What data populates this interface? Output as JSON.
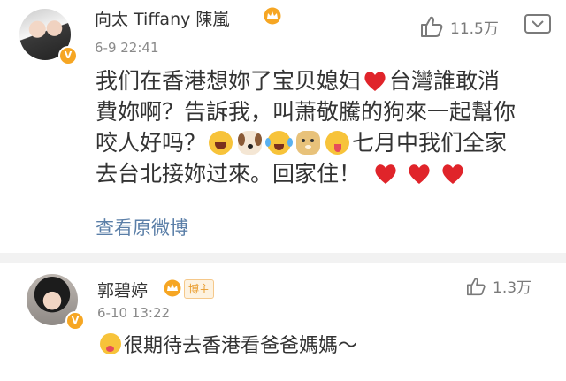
{
  "comments": [
    {
      "name": "向太 Tiffany 陳嵐",
      "time": "6-9 22:41",
      "likes": "11.5万",
      "text": {
        "l1a": "我们在香港想妳了宝贝媳妇",
        "l1b": "台灣誰敢消",
        "l2": "費妳啊？告訴我，叫萧敬騰的狗來一起幫你",
        "l3a": "咬人好吗？",
        "l3b": "七月中我们全家",
        "l4": "去台北接妳过來。回家住！"
      },
      "view_original": "查看原微博",
      "emoji_icons": [
        "red-heart",
        "laughing-face",
        "puppy",
        "tears-of-joy",
        "doge",
        "tongue-face",
        "red-heart",
        "red-heart",
        "red-heart"
      ]
    },
    {
      "name": "郭碧婷",
      "badge": "博主",
      "time": "6-10 13:22",
      "likes": "1.3万",
      "text": "很期待去香港看爸爸媽媽～",
      "emoji_icons": [
        "drooling-face"
      ]
    }
  ],
  "colors": {
    "accent_link": "#5b7fa8",
    "heart": "#e0242a",
    "badge": "#f6a623",
    "separator": "#f2f2f2"
  }
}
